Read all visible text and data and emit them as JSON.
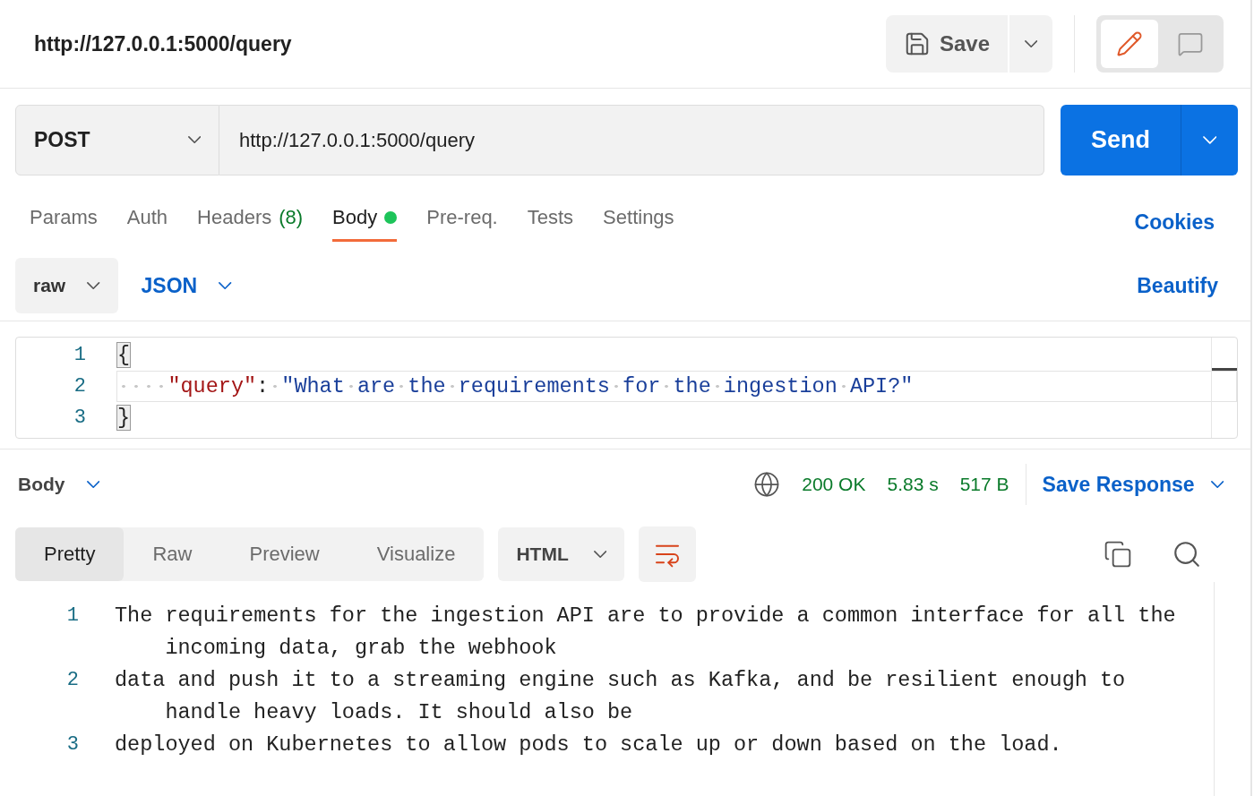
{
  "header": {
    "title": "http://127.0.0.1:5000/query",
    "save": "Save",
    "modes": [
      {
        "kind": "edit",
        "selected": true
      },
      {
        "kind": "comment",
        "selected": false
      }
    ]
  },
  "request": {
    "method": "POST",
    "url": "http://127.0.0.1:5000/query",
    "send": "Send"
  },
  "tabs": [
    {
      "label": "Params",
      "selected": false
    },
    {
      "label": "Auth",
      "selected": false
    },
    {
      "label": "Headers",
      "count": "(8)",
      "selected": false
    },
    {
      "label": "Body",
      "selected": true,
      "indicator": true
    },
    {
      "label": "Pre-req.",
      "selected": false
    },
    {
      "label": "Tests",
      "selected": false
    },
    {
      "label": "Settings",
      "selected": false
    }
  ],
  "cookies": "Cookies",
  "body_options": {
    "mode": "raw",
    "format": "JSON",
    "beautify": "Beautify"
  },
  "editor": {
    "lines": [
      {
        "number": "1",
        "active": false,
        "tokens": [
          {
            "kind": "bracket",
            "text": "{"
          }
        ]
      },
      {
        "number": "2",
        "active": true,
        "tokens": [
          {
            "kind": "key",
            "text": "    \"query\""
          },
          {
            "kind": "punct",
            "text": ": "
          },
          {
            "kind": "string",
            "text": "\"What are the requirements for the ingestion API?\""
          }
        ]
      },
      {
        "number": "3",
        "active": false,
        "tokens": [
          {
            "kind": "bracket",
            "text": "}"
          }
        ]
      }
    ]
  },
  "response": {
    "section": "Body",
    "status": "200 OK",
    "time": "5.83 s",
    "size": "517 B",
    "save_response": "Save Response",
    "views": [
      {
        "label": "Pretty",
        "selected": true
      },
      {
        "label": "Raw",
        "selected": false
      },
      {
        "label": "Preview",
        "selected": false
      },
      {
        "label": "Visualize",
        "selected": false
      }
    ],
    "format": "HTML",
    "wrap": true,
    "lines": [
      {
        "number": "1",
        "text": "The requirements for the ingestion API are to provide a common interface for all the incoming data, grab the webhook"
      },
      {
        "number": "2",
        "text": "data and push it to a streaming engine such as Kafka, and be resilient enough to handle heavy loads. It should also be"
      },
      {
        "number": "3",
        "text": "deployed on Kubernetes to allow pods to scale up or down based on the load."
      }
    ]
  }
}
